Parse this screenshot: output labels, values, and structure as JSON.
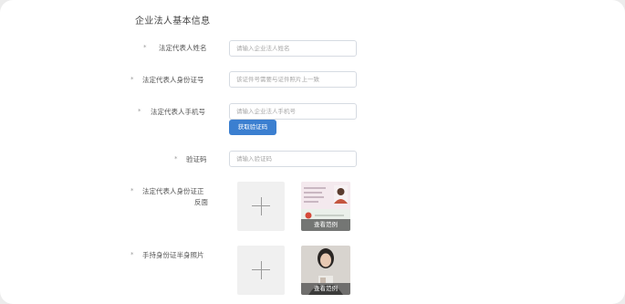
{
  "section_title": "企业法人基本信息",
  "required_mark": "*",
  "fields": {
    "name": {
      "label": "法定代表人姓名",
      "placeholder": "请输入企业法人姓名"
    },
    "id_number": {
      "label": "法定代表人身份证号",
      "placeholder": "该证件号需要与证件照片上一致"
    },
    "phone": {
      "label": "法定代表人手机号",
      "placeholder": "请输入企业法人手机号"
    },
    "code": {
      "label": "验证码",
      "placeholder": "请输入验证码"
    }
  },
  "get_code_button": "获取验证码",
  "uploads": {
    "id_card": {
      "label_line1": "法定代表人身份证正",
      "label_line2": "反面",
      "sample_caption": "查看范例"
    },
    "holding_id": {
      "label": "手持身份证半身照片",
      "sample_caption": "查看范例"
    }
  },
  "colors": {
    "accent": "#3b7fd0",
    "input_border": "#d6dbe2",
    "upload_bg": "#f0f0f0"
  },
  "icons": {
    "upload": "plus-icon"
  }
}
